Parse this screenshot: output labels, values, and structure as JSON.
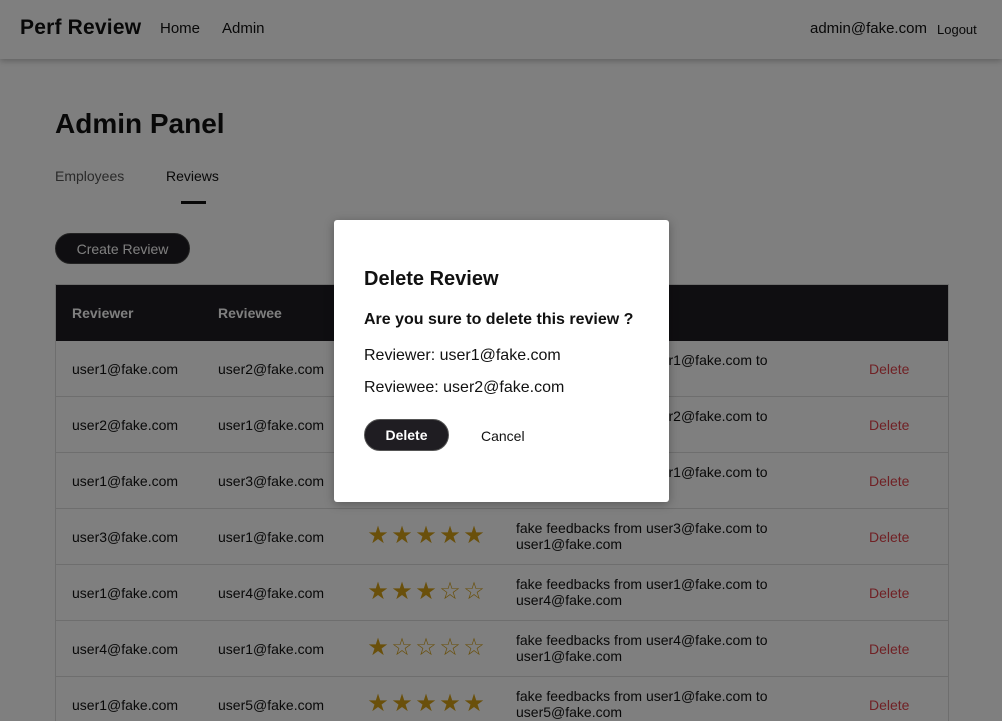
{
  "navbar": {
    "brand": "Perf Review",
    "links": [
      "Home",
      "Admin"
    ],
    "user_email": "admin@fake.com",
    "logout_label": "Logout"
  },
  "page": {
    "title": "Admin Panel",
    "tabs": [
      "Employees",
      "Reviews"
    ],
    "active_tab": "Reviews",
    "create_button_label": "Create Review"
  },
  "table": {
    "headers": [
      "Reviewer",
      "Reviewee"
    ],
    "rows": [
      {
        "reviewer": "user1@fake.com",
        "reviewee": "user2@fake.com",
        "rating": null,
        "feedback": "fake feedbacks from user1@fake.com to",
        "action": "Delete"
      },
      {
        "reviewer": "user2@fake.com",
        "reviewee": "user1@fake.com",
        "rating": null,
        "feedback": "fake feedbacks from user2@fake.com to",
        "action": "Delete"
      },
      {
        "reviewer": "user1@fake.com",
        "reviewee": "user3@fake.com",
        "rating": null,
        "feedback": "fake feedbacks from user1@fake.com to",
        "action": "Delete"
      },
      {
        "reviewer": "user3@fake.com",
        "reviewee": "user1@fake.com",
        "rating": 5,
        "feedback": "fake feedbacks from user3@fake.com to user1@fake.com",
        "action": "Delete"
      },
      {
        "reviewer": "user1@fake.com",
        "reviewee": "user4@fake.com",
        "rating": 3,
        "feedback": "fake feedbacks from user1@fake.com to user4@fake.com",
        "action": "Delete"
      },
      {
        "reviewer": "user4@fake.com",
        "reviewee": "user1@fake.com",
        "rating": 1,
        "feedback": "fake feedbacks from user4@fake.com to user1@fake.com",
        "action": "Delete"
      },
      {
        "reviewer": "user1@fake.com",
        "reviewee": "user5@fake.com",
        "rating": 5,
        "feedback": "fake feedbacks from user1@fake.com to user5@fake.com",
        "action": "Delete"
      }
    ],
    "max_rating": 5
  },
  "modal": {
    "title": "Delete Review",
    "question": "Are you sure to delete this review ?",
    "reviewer_line": "Reviewer: user1@fake.com",
    "reviewee_line": "Reviewee: user2@fake.com",
    "delete_label": "Delete",
    "cancel_label": "Cancel"
  },
  "colors": {
    "dark": "#1f1d22",
    "star": "#d4a017",
    "delete_link": "#e0434a",
    "overlay": "rgba(0,0,0,0.5)"
  }
}
